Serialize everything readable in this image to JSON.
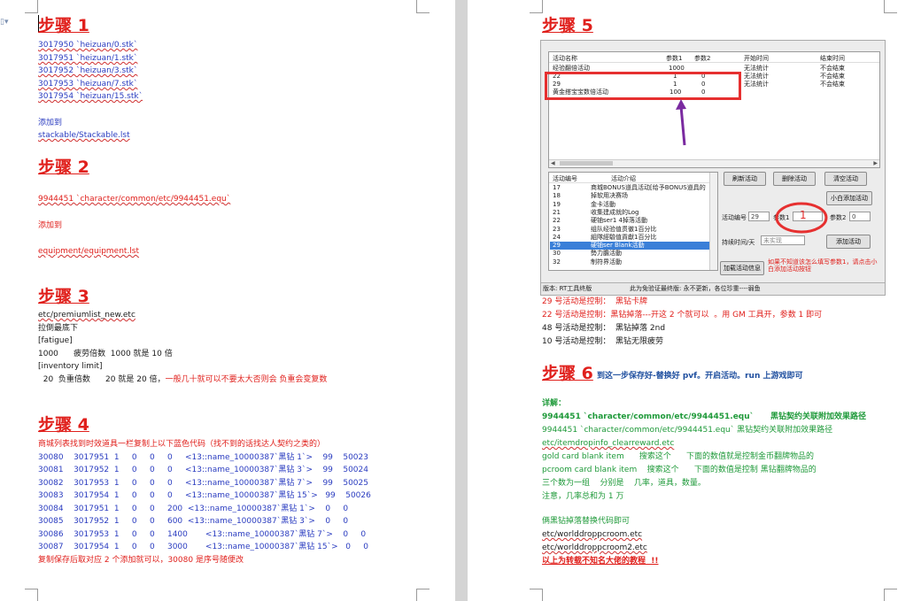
{
  "left": {
    "step1": {
      "title": "步骤 1",
      "lines": [
        "3017950 `heizuan/0.stk`",
        "3017951 `heizuan/1.stk`",
        "3017952 `heizuan/3.stk`",
        "3017953 `heizuan/7.stk`",
        "3017954 `heizuan/15.stk`"
      ],
      "add_to": "添加到",
      "path": "stackable/Stackable.lst"
    },
    "step2": {
      "title": "步骤 2",
      "line": "9944451 `character/common/etc/9944451.equ`",
      "add_to": "添加到",
      "path": "equipment/equipment.lst"
    },
    "step3": {
      "title": "步骤 3",
      "lines": [
        "etc/premiumlist_new.etc",
        "拉倒最底下",
        "[fatigue]",
        "1000      疲劳倍数  1000 就是 10 倍",
        "[inventory limit]"
      ],
      "last_black": "  20  负重倍数      20 就是 20 倍，",
      "last_red": "一般几十就可以不要太大否则会 负重会变复数"
    },
    "step4": {
      "title": "步骤 4",
      "intro": "商城列表找到时效道具一栏复制上以下蓝色代码（找不到的话找达人契约之类的）",
      "rows": [
        "30080    3017951  1     0     0     0     <13::name_10000387`黑钻 1`>    99    50023",
        "30081    3017952  1     0     0     0     <13::name_10000387`黑钻 3`>    99    50024",
        "30082    3017953  1     0     0     0     <13::name_10000387`黑钻 7`>    99    50025",
        "30083    3017954  1     0     0     0     <13::name_10000387`黑钻 15`>   99    50026",
        "30084    3017951  1     0     0     200  <13::name_10000387`黑钻 1`>    0     0",
        "30085    3017952  1     0     0     600  <13::name_10000387`黑钻 3`>    0     0",
        "30086    3017953  1     0     0     1400       <13::name_10000387`黑钻 7`>    0     0",
        "30087    3017954  1     0     0     3000       <13::name_10000387`黑钻 15`>   0     0"
      ],
      "outro": "复制保存后取对应 2 个添加就可以，30080 是序号随便改"
    }
  },
  "right": {
    "step5": {
      "title": "步骤 5"
    },
    "app": {
      "top_headers": [
        "活动名称",
        "参数1",
        "参数2",
        "开始时间",
        "结束时间"
      ],
      "top_rows": [
        [
          "经验翻倍活动",
          "1000",
          "",
          "无法统计",
          "不会结束"
        ],
        [
          "22",
          "1",
          "0",
          "无法统计",
          "不会结束"
        ],
        [
          "29",
          "1",
          "0",
          "无法统计",
          "不会结束"
        ],
        [
          "黄金搭宝宝数倍活动",
          "100",
          "0",
          "无法统计",
          "不会结束"
        ]
      ],
      "bottom_headers": [
        "活动编号",
        "活动介绍"
      ],
      "bottom_rows": [
        [
          "17",
          "商城BONUS道具活动[给予BONUS道具的"
        ],
        [
          "18",
          "掉软用决赛场"
        ],
        [
          "19",
          "金卡活動"
        ],
        [
          "21",
          "收集建成就的Log"
        ],
        [
          "22",
          "硬铀ser1 4掉落活動"
        ],
        [
          "23",
          "组队经验值贯徹1百分比"
        ],
        [
          "24",
          "組隊經驗值貢獻1百分比"
        ],
        [
          "29",
          "硬铀ser Blank活動"
        ],
        [
          "30",
          "勢力膽活動"
        ],
        [
          "32",
          "制符界活動"
        ]
      ],
      "selected_index": 7,
      "buttons": {
        "refresh": "刷新活动",
        "delete": "删除活动",
        "clear": "清空活动",
        "noob_add": "小白添加活动",
        "add": "添加活动",
        "add_info": "加载活动信息"
      },
      "labels": {
        "event_no": "活动编号",
        "event_no_value": "29",
        "param1": "参数1",
        "param2": "参数2",
        "param2_value": "0",
        "duration": "持续时间/天",
        "duration_placeholder": "未实现",
        "annotation_num": "1"
      },
      "hint": "如果不知道该怎么填写参数1，请点击小白添加活动按钮",
      "status_left": "版本: RT工具终版",
      "status_right": "此为免验证最终版: 永不更新，各位珍重----弱鱼"
    },
    "notes_after_app": [
      {
        "text": "29 号活动是控制：  黑钻卡牌",
        "color": "red"
      },
      {
        "text": "22 号活动是控制：黑钻掉落---开这 2 个就可以  。用 GM 工具开，参数 1 即可",
        "color": "red"
      },
      {
        "text": "48 号活动是控制：  黑钻掉落 2nd",
        "color": "black"
      },
      {
        "text": "10 号活动是控制：  黑钻无限疲劳",
        "color": "black"
      }
    ],
    "step6": {
      "title": "步骤 6",
      "subtitle": "到这一步保存好-替换好 pvf。开启活动。run 上游戏即可"
    },
    "details": {
      "heading": "详解：",
      "bold_line_a": "9944451 `character/common/etc/9944451.equ`",
      "bold_line_b": "      黑钻契约关联附加效果路径",
      "lines": [
        "9944451 `character/common/etc/9944451.equ` 黑钻契约关联附加效果路径",
        "etc/itemdropinfo_clearreward.etc",
        "gold card blank item      搜索这个      下面的数值就是控制金币翻牌物品的",
        "pcroom card blank item    搜索这个      下面的数值是控制 黑钻翻牌物品的",
        "三个数为一组    分别是    几率，道具，数量。",
        "注意，几率总和为 1 万"
      ],
      "replace_note": "俩黑钻掉落替换代码即可",
      "files": [
        "etc/worlddroppcroom.etc",
        "etc/worlddroppcroom2.etc"
      ],
      "footer": "以上为转载不知名大佬的教程  !!"
    }
  }
}
